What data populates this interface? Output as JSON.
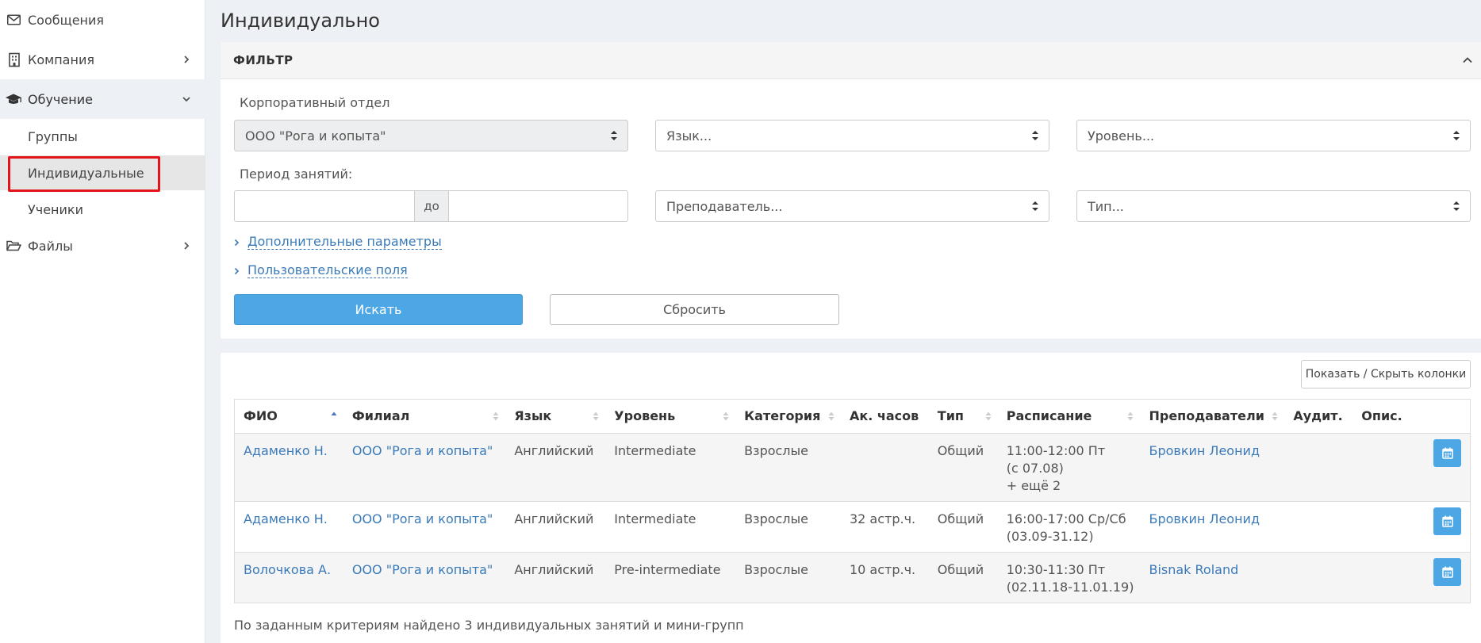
{
  "sidebar": {
    "items": [
      {
        "label": "Сообщения",
        "icon": "envelope-icon"
      },
      {
        "label": "Компания",
        "icon": "building-icon"
      },
      {
        "label": "Обучение",
        "icon": "graduation-cap-icon"
      },
      {
        "label": "Файлы",
        "icon": "folder-open-icon"
      }
    ],
    "subitems": [
      {
        "label": "Группы"
      },
      {
        "label": "Индивидуальные"
      },
      {
        "label": "Ученики"
      }
    ]
  },
  "page": {
    "title": "Индивидуально"
  },
  "filter": {
    "title": "ФИЛЬТР",
    "dept_label": "Корпоративный отдел",
    "dept_value": "ООО \"Рога и копыта\"",
    "lang_placeholder": "Язык...",
    "level_placeholder": "Уровень...",
    "period_label": "Период занятий:",
    "period_to": "до",
    "teacher_placeholder": "Преподаватель...",
    "type_placeholder": "Тип...",
    "extra_params": "Дополнительные параметры",
    "custom_fields": "Пользовательские поля",
    "search_btn": "Искать",
    "reset_btn": "Сбросить"
  },
  "results": {
    "toggle_columns": "Показать / Скрыть колонки",
    "columns": [
      "ФИО",
      "Филиал",
      "Язык",
      "Уровень",
      "Категория",
      "Ак. часов",
      "Тип",
      "Расписание",
      "Преподаватели",
      "Аудит.",
      "Опис."
    ],
    "rows": [
      {
        "fio": "Адаменко Н.",
        "branch": "ООО \"Рога и копыта\"",
        "lang": "Английский",
        "level": "Intermediate",
        "category": "Взрослые",
        "hours": "",
        "type": "Общий",
        "schedule1": "11:00-12:00 Пт",
        "schedule2": "(с 07.08)",
        "schedule3": "+ ещё 2",
        "teacher": "Бровкин Леонид"
      },
      {
        "fio": "Адаменко Н.",
        "branch": "ООО \"Рога и копыта\"",
        "lang": "Английский",
        "level": "Intermediate",
        "category": "Взрослые",
        "hours": "32 астр.ч.",
        "type": "Общий",
        "schedule1": "16:00-17:00 Ср/Сб",
        "schedule2": "(03.09-31.12)",
        "schedule3": "",
        "teacher": "Бровкин Леонид"
      },
      {
        "fio": "Волочкова А.",
        "branch": "ООО \"Рога и копыта\"",
        "lang": "Английский",
        "level": "Pre-intermediate",
        "category": "Взрослые",
        "hours": "10 астр.ч.",
        "type": "Общий",
        "schedule1": "10:30-11:30 Пт",
        "schedule2": "(02.11.18-11.01.19)",
        "schedule3": "",
        "teacher": "Bisnak Roland"
      }
    ],
    "summary": "По заданным критериям найдено 3 индивидуальных занятий и мини-групп"
  },
  "colors": {
    "accent": "#4ea7e5",
    "link": "#3a7ab8",
    "highlight": "#e4141b"
  }
}
